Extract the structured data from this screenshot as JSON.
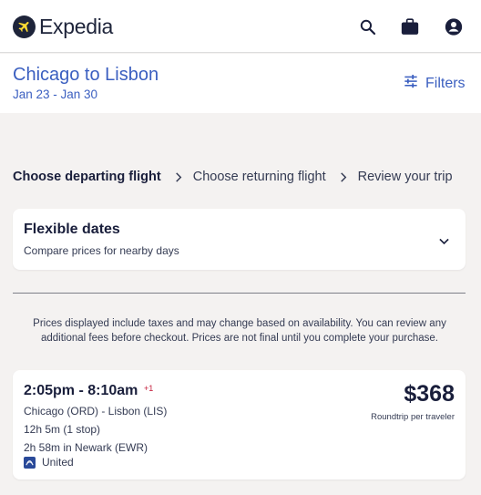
{
  "brand": {
    "name": "Expedia"
  },
  "topbar": {
    "icons": [
      "search-icon",
      "briefcase-icon",
      "account-icon"
    ]
  },
  "trip": {
    "title": "Chicago to Lisbon",
    "dates": "Jan 23 - Jan 30",
    "filters_label": "Filters"
  },
  "steps": [
    {
      "label": "Choose departing flight",
      "active": true
    },
    {
      "label": "Choose returning flight",
      "active": false
    },
    {
      "label": "Review your trip",
      "active": false
    }
  ],
  "flexible_dates": {
    "title": "Flexible dates",
    "subtitle": "Compare prices for nearby days"
  },
  "disclaimer": "Prices displayed include taxes and may change based on availability. You can review any additional fees before checkout. Prices are not final until you complete your purchase.",
  "flight": {
    "times": "2:05pm - 8:10am",
    "day_offset": "+1",
    "airports": "Chicago (ORD) - Lisbon (LIS)",
    "duration": "12h 5m (1 stop)",
    "layover": "2h 58m in Newark (EWR)",
    "airline": "United",
    "price": "$368",
    "price_note": "Roundtrip per traveler"
  },
  "colors": {
    "accent": "#3b5fc0",
    "text": "#191e3b",
    "background": "#f4f2f1",
    "day_offset": "#c41c3a"
  }
}
